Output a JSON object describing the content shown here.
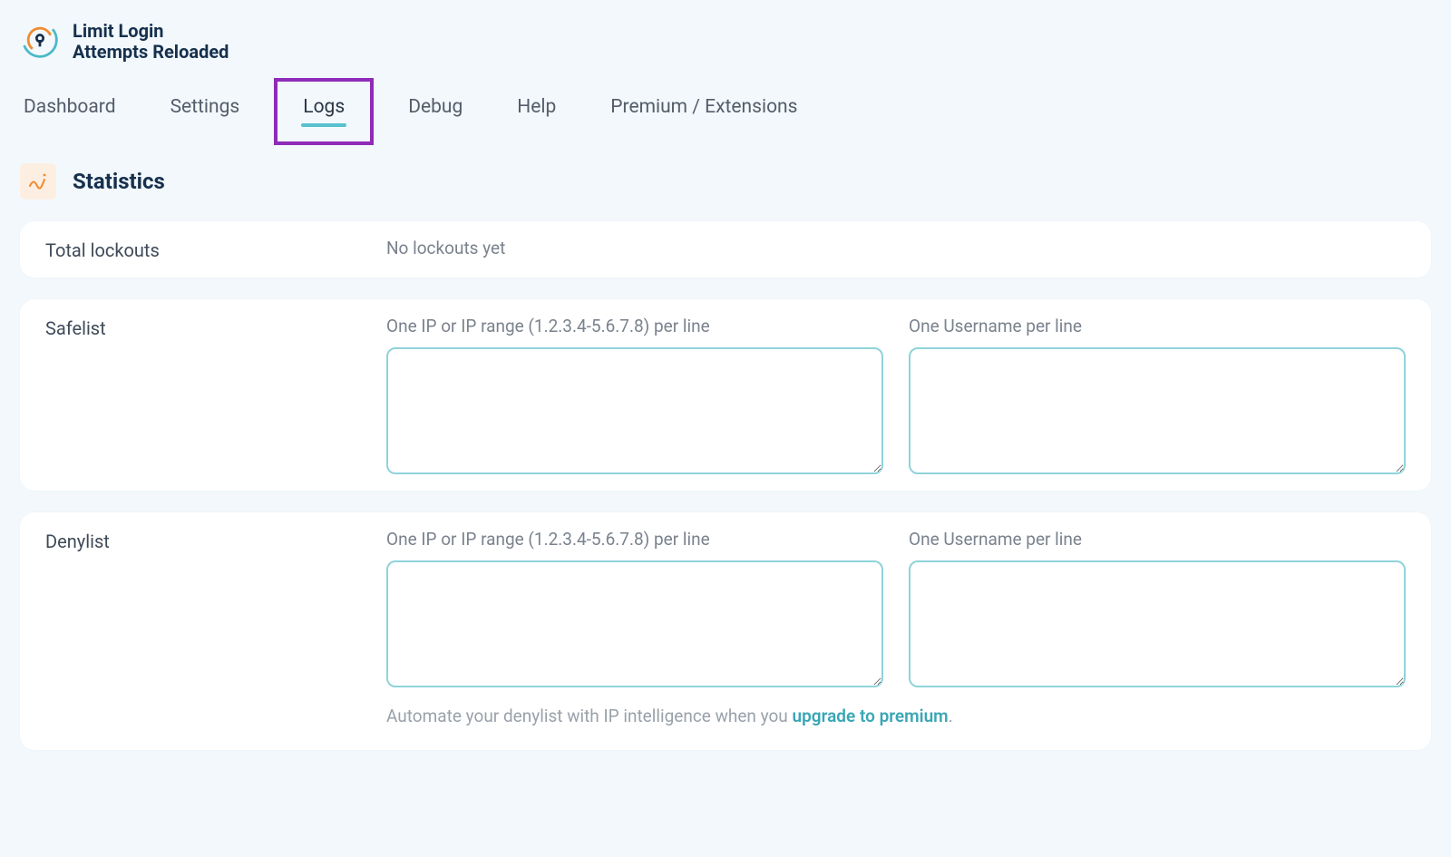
{
  "brand": {
    "line1": "Limit Login",
    "line2": "Attempts Reloaded"
  },
  "nav": {
    "items": [
      {
        "label": "Dashboard",
        "active": false
      },
      {
        "label": "Settings",
        "active": false
      },
      {
        "label": "Logs",
        "active": true,
        "highlighted": true
      },
      {
        "label": "Debug",
        "active": false
      },
      {
        "label": "Help",
        "active": false
      },
      {
        "label": "Premium / Extensions",
        "active": false
      }
    ]
  },
  "section_title": "Statistics",
  "lockouts": {
    "label": "Total lockouts",
    "value": "No lockouts yet"
  },
  "safelist": {
    "label": "Safelist",
    "ip_label": "One IP or IP range (1.2.3.4-5.6.7.8) per line",
    "user_label": "One Username per line",
    "ip_value": "",
    "user_value": ""
  },
  "denylist": {
    "label": "Denylist",
    "ip_label": "One IP or IP range (1.2.3.4-5.6.7.8) per line",
    "user_label": "One Username per line",
    "ip_value": "",
    "user_value": "",
    "footnote_prefix": "Automate your denylist with IP intelligence when you ",
    "footnote_link": "upgrade to premium",
    "footnote_suffix": "."
  }
}
